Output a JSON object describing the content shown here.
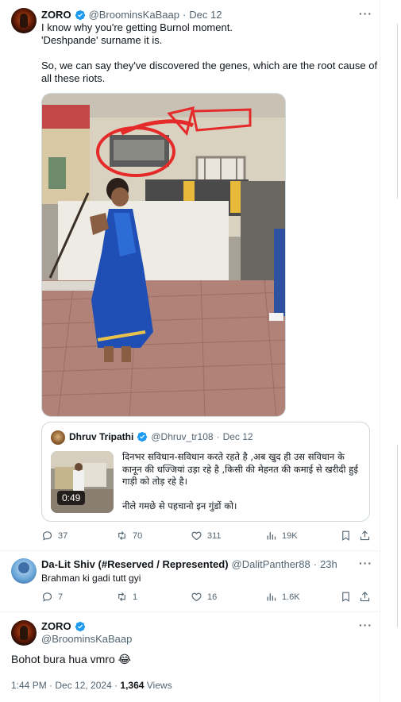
{
  "tweet": {
    "author": "ZORO",
    "handle": "@BroominsKaBaap",
    "date": "Dec 12",
    "more": "···",
    "lines": [
      "I know why you're getting Burnol moment.",
      "'Deshpande' surname it is.",
      "So, we can say they've discovered the genes, which are the root cause of",
      "all these riots."
    ],
    "quote": {
      "author": "Dhruv Tripathi",
      "handle": "@Dhruv_tr108",
      "date": "Dec 12",
      "video_time": "0:49",
      "text_lines": [
        "दिनभर सविधान-सविधान करते रहते है ,अब खुद ही उस सविधान के",
        "कानून की धज्जियां उड़ा रहे है ,किसी की मेहनत की कमाई से खरीदी हुई",
        "गाड़ी को तोड़ रहे है।",
        "नीले गमछे से पहचानो इन गुंडों को।"
      ]
    },
    "actions": {
      "replies": "37",
      "reposts": "70",
      "likes": "311",
      "views": "19K"
    }
  },
  "reply1": {
    "author": "Da-Lit Shiv (#Reserved / Represented)",
    "handle": "@DalitPanther88",
    "time": "23h",
    "more": "···",
    "text": "Brahman ki gadi tutt gyi",
    "actions": {
      "replies": "7",
      "reposts": "1",
      "likes": "16",
      "views": "1.6K"
    }
  },
  "reply2": {
    "author": "ZORO",
    "handle": "@BroominsKaBaap",
    "more": "···",
    "text": "Bohot bura hua vmro 😂",
    "timestamp": "1:44 PM · Dec 12, 2024 · ",
    "view_count": "1,364",
    "views_label": " Views"
  },
  "colors": {
    "accent": "#1d9bf0",
    "muted": "#536471",
    "border": "#cfd9de",
    "text": "#0f1419"
  },
  "icons": [
    "verified-badge-icon",
    "reply-icon",
    "repost-icon",
    "like-icon",
    "views-icon",
    "bookmark-icon",
    "share-icon",
    "more-icon"
  ]
}
